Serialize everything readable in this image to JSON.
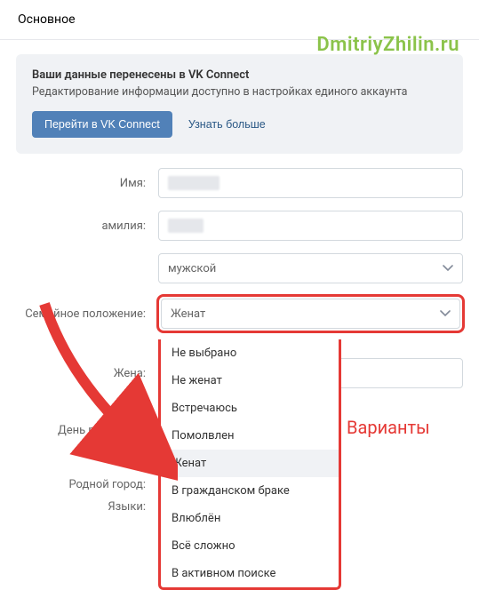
{
  "page_title": "Основное",
  "watermark": "DmitriyZhilin.ru",
  "notice": {
    "title": "Ваши данные перенесены в VK Connect",
    "desc": "Редактирование информации доступно в настройках единого аккаунта",
    "primary_btn": "Перейти в VK Connect",
    "link_btn": "Узнать больше"
  },
  "form": {
    "name_label": "Имя:",
    "surname_label": "амилия:",
    "gender_value": "мужской",
    "marital_label": "Семейное положение:",
    "marital_value": "Женат",
    "wife_label": "Жена:",
    "birthday_label": "День рождения:",
    "hometown_label": "Родной город:",
    "languages_label": "Языки:"
  },
  "dropdown": {
    "items": [
      "Не выбрано",
      "Не женат",
      "Встречаюсь",
      "Помолвлен",
      "Женат",
      "В гражданском браке",
      "Влюблён",
      "Всё сложно",
      "В активном поиске"
    ],
    "selected_index": 4
  },
  "annotation": {
    "variants": "Варианты"
  },
  "colors": {
    "highlight": "#e53935",
    "primary": "#5181b8",
    "watermark": "#8bc34a"
  }
}
